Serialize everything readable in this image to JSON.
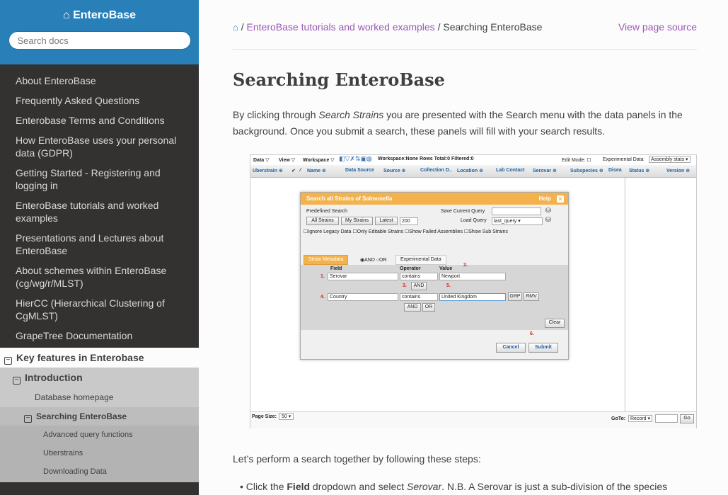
{
  "sidebar": {
    "brand": "EnteroBase",
    "search_placeholder": "Search docs",
    "items": [
      "About EnteroBase",
      "Frequently Asked Questions",
      "Enterobase Terms and Conditions",
      "How EnteroBase uses your personal data (GDPR)",
      "Getting Started - Registering and logging in",
      "EnteroBase tutorials and worked examples",
      "Presentations and Lectures about EnteroBase",
      "About schemes within EnteroBase (cg/wg/r/MLST)",
      "HierCC (Hierarchical Clustering of CgMLST)",
      "GrapeTree Documentation"
    ],
    "current": "Key features in Enterobase",
    "level2": "Introduction",
    "level3_a": "Database homepage",
    "level3_b": "Searching EnteroBase",
    "level4": [
      "Advanced query functions",
      "Uberstrains",
      "Downloading Data"
    ]
  },
  "breadcrumb": {
    "sep": "/",
    "link": "EnteroBase tutorials and worked examples",
    "current": "Searching EnteroBase",
    "view_source": "View page source"
  },
  "page": {
    "title": "Searching EnteroBase",
    "intro_1": "By clicking through ",
    "intro_em": "Search Strains",
    "intro_2": " you are presented with the Search menu with the data panels in the background. Once you submit a search, these panels will fill with your search results.",
    "steps_intro": "Let’s perform a search together by following these steps:",
    "bullet_1": "Click the ",
    "bullet_b": "Field",
    "bullet_2": " dropdown and select ",
    "bullet_em": "Serovar",
    "bullet_3": ". N.B. A Serovar is just a sub-division of the species"
  },
  "screenshot": {
    "toolbar": {
      "data": "Data ▽",
      "view": "View ▽",
      "workspace": "Workspace ▽",
      "ws_status": "Workspace:None   Rows Total:0 Filtered:0",
      "edit_mode": "Edit Mode: ☐",
      "exp_data": "Experimental Data",
      "assembly": "Assembly stats ▾"
    },
    "columns": [
      "Uberstrain ⊕",
      "✔",
      "⁄",
      "Name ⊕",
      "Data Source",
      "Source ⊕",
      "Collection D..",
      "Location ⊕",
      "Lab Contact",
      "Serovar ⊕",
      "Subspecies ⊕",
      "Disea",
      "Status ⊕",
      "Version ⊕"
    ],
    "footer": {
      "page_size": "Page Size:",
      "page_size_val": "50 ▾",
      "goto": "GoTo:",
      "record": "Record ▾",
      "go": "Go"
    },
    "dialog": {
      "title": "Search all Strains of Salmonella",
      "help": "Help",
      "close": "✕",
      "predefined": "Predefined Search",
      "save_query": "Save Current Query",
      "all_strains": "All Strains",
      "my_strains": "My Strains",
      "latest": "Latest",
      "latest_n": "200",
      "load_query": "Load Query",
      "load_val": "last_query ▾",
      "checks": "☐Ignore Legacy Data ☐Only Editable Strains ☐Show Failed Assemblies ☐Show Sub Strains",
      "tab1": "Strain Metadata",
      "radio": "◉AND ○OR",
      "tab2": "Experimental Data",
      "field": "Field",
      "operator": "Operator",
      "value": "Value",
      "row1_field": "Serovar",
      "row1_op": "contains",
      "row1_val": "Newport",
      "row2_field": "Country",
      "row2_op": "contains",
      "row2_val": "United Kingdom",
      "and": "AND",
      "or": "OR",
      "grp": "GRP",
      "rmv": "RMV",
      "clear": "Clear",
      "cancel": "Cancel",
      "submit": "Submit",
      "n1": "1.",
      "n2": "2.",
      "n3": "3.",
      "n4": "4.",
      "n5": "5.",
      "n6": "6."
    }
  }
}
